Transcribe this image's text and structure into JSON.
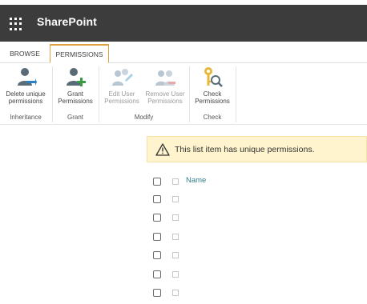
{
  "app": {
    "title": "SharePoint"
  },
  "tabs": [
    {
      "label": "BROWSE"
    },
    {
      "label": "PERMISSIONS",
      "active": true
    }
  ],
  "ribbon": {
    "groups": [
      {
        "label": "Inheritance",
        "buttons": [
          {
            "line1": "Delete unique",
            "line2": "permissions",
            "icon": "delete-unique-permissions-icon",
            "enabled": true
          }
        ]
      },
      {
        "label": "Grant",
        "buttons": [
          {
            "line1": "Grant",
            "line2": "Permissions",
            "icon": "grant-permissions-icon",
            "enabled": true
          }
        ]
      },
      {
        "label": "Modify",
        "buttons": [
          {
            "line1": "Edit User",
            "line2": "Permissions",
            "icon": "edit-user-permissions-icon",
            "enabled": false
          },
          {
            "line1": "Remove User",
            "line2": "Permissions",
            "icon": "remove-user-permissions-icon",
            "enabled": false
          }
        ]
      },
      {
        "label": "Check",
        "buttons": [
          {
            "line1": "Check",
            "line2": "Permissions",
            "icon": "check-permissions-icon",
            "enabled": true
          }
        ]
      }
    ]
  },
  "banner": {
    "message": "This list item has unique permissions.",
    "icon": "warning-icon"
  },
  "table": {
    "columns": [
      {
        "label": "Name"
      }
    ],
    "rows": [
      {
        "name": ""
      },
      {
        "name": ""
      },
      {
        "name": ""
      },
      {
        "name": ""
      },
      {
        "name": ""
      },
      {
        "name": ""
      }
    ]
  },
  "colors": {
    "suitebar": "#3c3c3c",
    "accent": "#e0a040",
    "banner_bg": "#fff4ce",
    "link": "#2f7d8a"
  }
}
